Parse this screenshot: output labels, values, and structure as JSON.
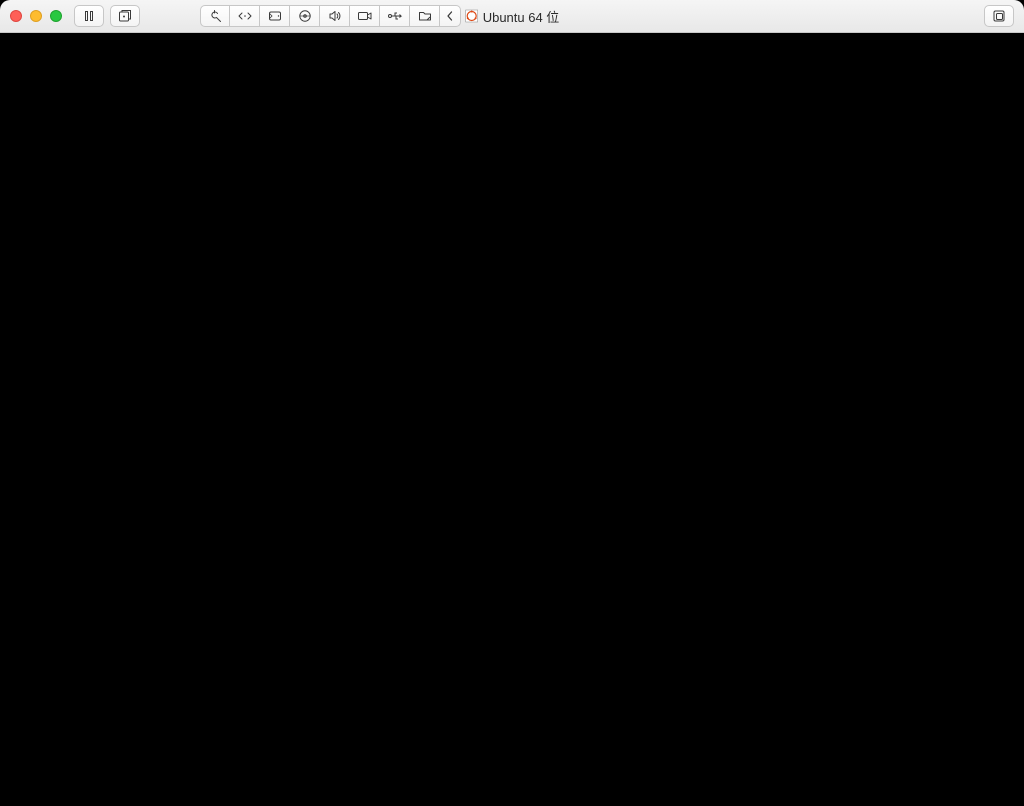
{
  "window": {
    "title": "Ubuntu 64 位"
  },
  "toolbar": {
    "icons": {
      "pause": "pause-icon",
      "snapshot": "snapshot-icon",
      "settings": "wrench-icon",
      "resize": "resize-icon",
      "disk": "disk-icon",
      "cdrom": "cdrom-icon",
      "sound": "sound-icon",
      "camera": "camera-icon",
      "usb": "usb-icon",
      "shared_folder": "shared-folder-icon",
      "collapse": "chevron-left-icon",
      "fullscreen": "fullscreen-icon"
    }
  }
}
